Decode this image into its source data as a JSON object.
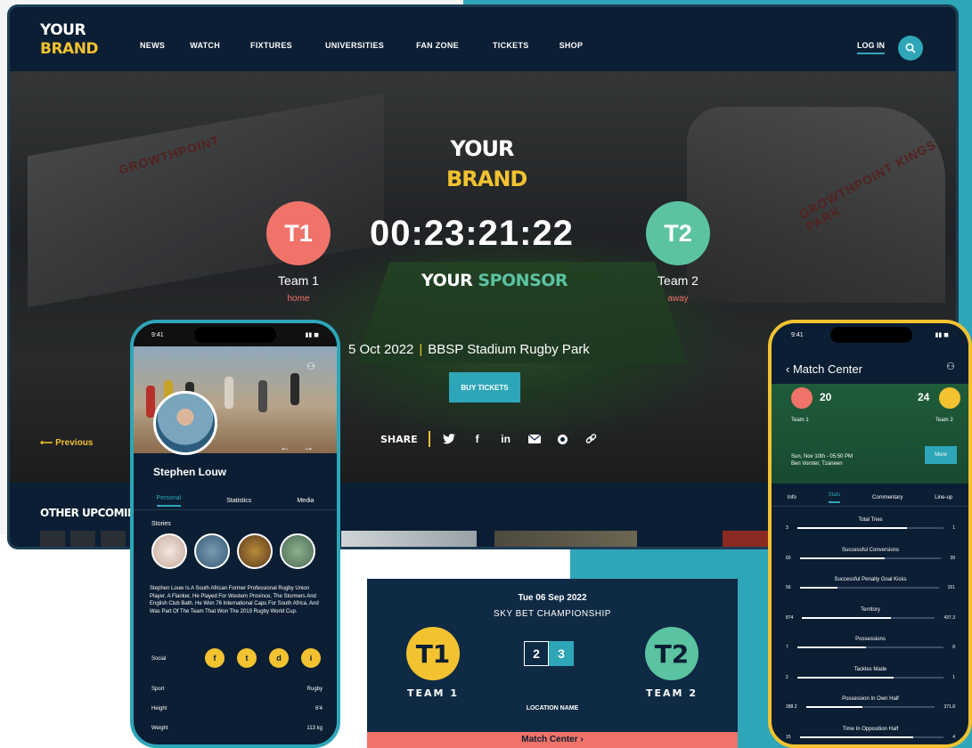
{
  "brand": {
    "line1": "YOUR",
    "line2": "BRAND"
  },
  "nav": {
    "items": [
      "NEWS",
      "WATCH",
      "FIXTURES",
      "UNIVERSITIES",
      "FAN ZONE",
      "TICKETS",
      "SHOP"
    ],
    "login": "LOG IN"
  },
  "hero": {
    "brand_line1": "YOUR",
    "brand_line2": "BRAND",
    "team1": {
      "badge": "T1",
      "name": "Team 1",
      "sub": "home"
    },
    "team2": {
      "badge": "T2",
      "name": "Team 2",
      "sub": "away"
    },
    "countdown": "00:23:21:22",
    "sponsor_1": "YOUR",
    "sponsor_2": "SPONSOR",
    "date": "5 Oct 2022",
    "venue": "BBSP Stadium Rugby Park",
    "buy_label": "BUY TICKETS",
    "share_label": "SHARE",
    "prev_label": "Previous",
    "upcoming_label": "OTHER UPCOMING",
    "roof_text_left": "GROWTHPOINT",
    "roof_text_right": "GROWTHPOINT KINGS PARK"
  },
  "profile_phone": {
    "time": "9:41",
    "name": "Stephen Louw",
    "tabs": [
      "Personal",
      "Statistics",
      "Media"
    ],
    "stories_label": "Stories",
    "bio": "Stephen Louw Is A South African Former Professional Rugby Union Player. A Flanker, He Played For Western Province, The Stormers And English Club Bath. He Won 76 International Caps For South Africa, And Was Part Of The Team That Won The 2019 Rugby World Cup.",
    "social_label": "Social",
    "socials": [
      "f",
      "t",
      "d",
      "i"
    ],
    "stats": [
      {
        "label": "Sport",
        "value": "Rugby"
      },
      {
        "label": "Height",
        "value": "6'4"
      },
      {
        "label": "Weight",
        "value": "113 kg"
      }
    ]
  },
  "match_card": {
    "date": "Tue 06 Sep 2022",
    "competition": "SKY BET CHAMPIONSHIP",
    "team1_badge": "T1",
    "team2_badge": "T2",
    "team1_label": "TEAM 1",
    "team2_label": "TEAM 2",
    "score1": "2",
    "score2": "3",
    "location": "LOCATION NAME",
    "cta": "Match Center ›"
  },
  "match_phone": {
    "time": "9:41",
    "title": "‹ Match Center",
    "score1": "20",
    "score2": "24",
    "team1": "Team 1",
    "team2": "Team 2",
    "info_line1": "Sun, Nov 10th - 05:50 PM",
    "info_line2": "Ben Vorster, Tzaneen",
    "more_label": "More",
    "tabs": [
      "Info",
      "Stats",
      "Commentary",
      "Line-up"
    ],
    "stats": [
      {
        "label": "Total Tries",
        "left": "3",
        "right": "1",
        "ratio": 0.75
      },
      {
        "label": "Successful Conversions",
        "left": "60",
        "right": "39",
        "ratio": 0.6
      },
      {
        "label": "Successful Penalty Goal Kicks",
        "left": "56",
        "right": "151",
        "ratio": 0.27
      },
      {
        "label": "Territory",
        "left": "874",
        "right": "437.3",
        "ratio": 0.67
      },
      {
        "label": "Possessions",
        "left": "7",
        "right": "8",
        "ratio": 0.47
      },
      {
        "label": "Tackles Made",
        "left": "2",
        "right": "1",
        "ratio": 0.66
      },
      {
        "label": "Possession In Own Half",
        "left": "288.2",
        "right": "371.8",
        "ratio": 0.44
      },
      {
        "label": "Time In Opposition Half",
        "left": "15",
        "right": "4",
        "ratio": 0.79
      }
    ]
  },
  "colors": {
    "navy": "#0b1e33",
    "teal": "#2ea6b8",
    "yellow": "#f2c230",
    "coral": "#f0736a",
    "green": "#5bc3a1"
  }
}
